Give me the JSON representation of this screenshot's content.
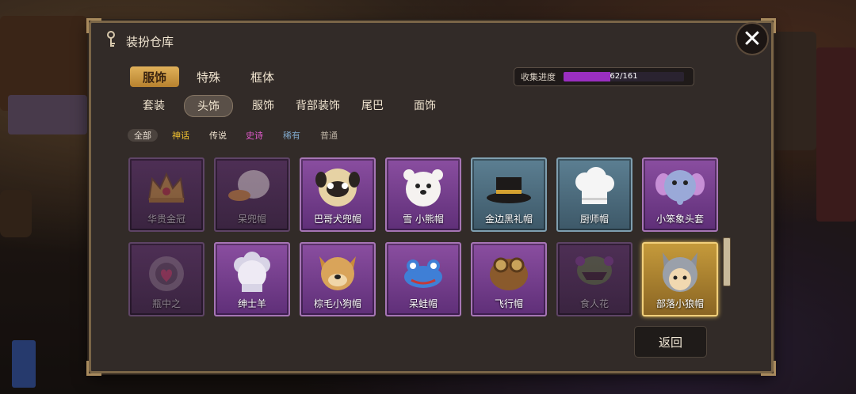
{
  "window": {
    "title": "装扮仓库",
    "close_label": "✕"
  },
  "category_tabs": [
    {
      "label": "服饰",
      "active": true
    },
    {
      "label": "特殊",
      "active": false
    },
    {
      "label": "框体",
      "active": false
    }
  ],
  "progress": {
    "label": "收集进度",
    "value": 62,
    "total": 161,
    "text": "62/161"
  },
  "sub_tabs": [
    {
      "label": "套装",
      "active": false
    },
    {
      "label": "头饰",
      "active": true
    },
    {
      "label": "服饰",
      "active": false
    },
    {
      "label": "背部装饰",
      "active": false
    },
    {
      "label": "尾巴",
      "active": false
    },
    {
      "label": "面饰",
      "active": false
    }
  ],
  "rarity_filters": [
    {
      "label": "全部",
      "color": "#e6dcd0",
      "active": true
    },
    {
      "label": "神话",
      "color": "#f2c230",
      "active": false
    },
    {
      "label": "传说",
      "color": "#f2e6d2",
      "active": false
    },
    {
      "label": "史诗",
      "color": "#e05acb",
      "active": false
    },
    {
      "label": "稀有",
      "color": "#7fa6c8",
      "active": false
    },
    {
      "label": "普通",
      "color": "#b8aea0",
      "active": false
    }
  ],
  "items": [
    {
      "name": "华贵金冠",
      "rarity": "epic-dim",
      "locked": true,
      "icon": "crown-icon"
    },
    {
      "name": "呆兜帽",
      "rarity": "epic-dim",
      "locked": true,
      "icon": "duck-hood-icon"
    },
    {
      "name": "巴哥犬兜帽",
      "rarity": "epic",
      "locked": false,
      "icon": "pug-hood-icon"
    },
    {
      "name": "雪 小熊帽",
      "rarity": "epic",
      "locked": false,
      "icon": "bear-hat-icon"
    },
    {
      "name": "金边黑礼帽",
      "rarity": "rare",
      "locked": false,
      "icon": "top-hat-icon"
    },
    {
      "name": "厨师帽",
      "rarity": "rare",
      "locked": false,
      "icon": "chef-hat-icon"
    },
    {
      "name": "小笨象头套",
      "rarity": "epic",
      "locked": false,
      "icon": "elephant-hood-icon"
    },
    {
      "name": "瓶中之",
      "rarity": "epic-dim",
      "locked": true,
      "icon": "jar-icon"
    },
    {
      "name": "绅士羊",
      "rarity": "epic",
      "locked": false,
      "icon": "sheep-hood-icon"
    },
    {
      "name": "棕毛小狗帽",
      "rarity": "epic",
      "locked": false,
      "icon": "dog-hat-icon"
    },
    {
      "name": "呆蛙帽",
      "rarity": "epic",
      "locked": false,
      "icon": "frog-hat-icon"
    },
    {
      "name": "飞行帽",
      "rarity": "epic",
      "locked": false,
      "icon": "aviator-hat-icon"
    },
    {
      "name": "食人花",
      "rarity": "epic-dim",
      "locked": true,
      "icon": "piranha-plant-icon"
    },
    {
      "name": "部落小狼帽",
      "rarity": "selected",
      "locked": false,
      "icon": "wolf-hood-icon"
    }
  ],
  "back_button": {
    "label": "返回"
  }
}
